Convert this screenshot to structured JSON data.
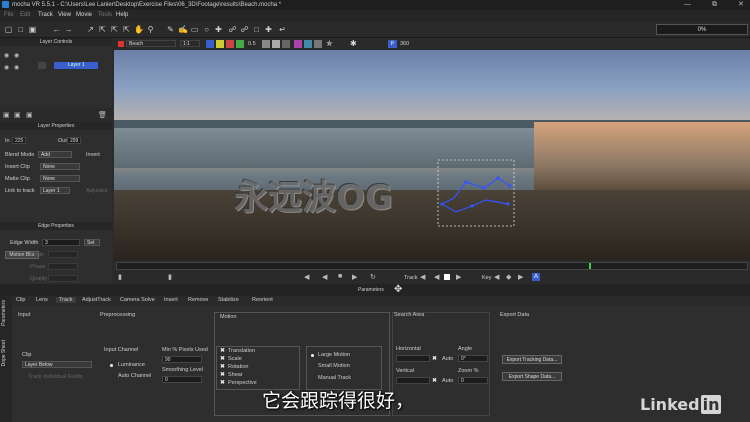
{
  "window": {
    "title": "mocha VR 5.5.1 - C:\\Users\\Lee Lanier\\Desktop\\Exercise Files\\06_3D\\Footage\\results\\Beach.mocha *"
  },
  "menu": [
    {
      "label": "File",
      "enabled": false
    },
    {
      "label": "Edit",
      "enabled": false
    },
    {
      "label": "Track",
      "enabled": true
    },
    {
      "label": "View",
      "enabled": true
    },
    {
      "label": "Movie",
      "enabled": true
    },
    {
      "label": "Tools",
      "enabled": false
    },
    {
      "label": "Help",
      "enabled": true
    }
  ],
  "progress": {
    "text": "0%"
  },
  "layer_controls": {
    "header": "Layer Controls",
    "layers": [
      {
        "name": "Layer 1"
      }
    ]
  },
  "layer_properties": {
    "header": "Layer Properties",
    "in_label": "In",
    "in_value": "225",
    "out_label": "Out",
    "out_value": "299",
    "blend_mode_label": "Blend Mode",
    "blend_mode_value": "Add",
    "invert_label": "Invert",
    "insert_clip_label": "Insert Clip",
    "insert_clip_value": "None",
    "matte_clip_label": "Matte Clip",
    "matte_clip_value": "None",
    "link_to_track_label": "Link to track",
    "link_to_track_value": "Layer 1",
    "adjusted_label": "Adjusted"
  },
  "edge_properties": {
    "header": "Edge Properties",
    "edge_width_label": "Edge Width",
    "edge_width_value": "3",
    "set_label": "Set",
    "motion_blur_label": "Motion Blur",
    "angle_label": "Angle",
    "phase_label": "Phase",
    "quality_label": "Quality"
  },
  "viewer": {
    "clip_name": "Beach",
    "zoom": "1:1",
    "proxy": "0.5",
    "view_mode": "360"
  },
  "timeline": {
    "track_label": "Track",
    "key_label": "Key"
  },
  "parameters_label": "Parameters",
  "side_tabs": [
    "Parameters",
    "Dope Sheet"
  ],
  "tabs": [
    "Clip",
    "Lens",
    "Track",
    "AdjustTrack",
    "Camera Solve",
    "Insert",
    "Remove",
    "Stabilize",
    "Reorient"
  ],
  "active_tab": "Track",
  "track_params": {
    "input_header": "Input",
    "clip_label": "Clip",
    "clip_value": "Layer Below",
    "track_individual_label": "Track Individual Fields",
    "preprocessing_header": "Preprocessing",
    "input_channel_label": "Input Channel",
    "luminance_label": "Luminance",
    "auto_channel_label": "Auto Channel",
    "min_pixels_label": "Min % Pixels Used",
    "min_pixels_value": "90",
    "smoothing_label": "Smoothing Level",
    "smoothing_value": "0",
    "motion_header": "Motion",
    "motion_options": [
      "Translation",
      "Scale",
      "Rotation",
      "Shear",
      "Perspective"
    ],
    "motion_types": [
      "Large Motion",
      "Small Motion",
      "Manual Track"
    ],
    "search_area_header": "Search Area",
    "horizontal_label": "Horizontal",
    "vertical_label": "Vertical",
    "auto_label": "Auto",
    "angle_label": "Angle",
    "angle_value": "0°",
    "zoom_label": "Zoom %",
    "zoom_value": "0",
    "export_header": "Export Data",
    "export_tracking_label": "Export Tracking Data...",
    "export_shape_label": "Export Shape Data..."
  },
  "subtitle": "它会跟踪得很好，",
  "watermark": {
    "text": "Linked",
    "badge": "in"
  },
  "colors": {
    "accent": "#3a5fcd",
    "spline": "#3355ff",
    "background": "#2b2b2b"
  }
}
